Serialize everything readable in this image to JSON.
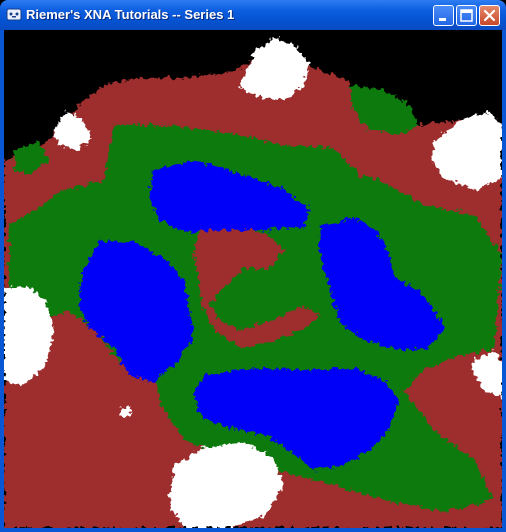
{
  "window": {
    "title": "Riemer's XNA Tutorials -- Series 1",
    "controls": {
      "minimize": "minimize",
      "maximize": "maximize",
      "close": "close"
    }
  },
  "colors": {
    "titlebar": "#0552d0",
    "terrain_red": "#9e2e2e",
    "terrain_green": "#0a7a0a",
    "water_blue": "#0000f8",
    "snow_white": "#ffffff",
    "close_button": "#c8472a",
    "background": "#000000"
  },
  "icons": [
    "app-icon",
    "minimize-icon",
    "maximize-icon",
    "close-icon"
  ]
}
